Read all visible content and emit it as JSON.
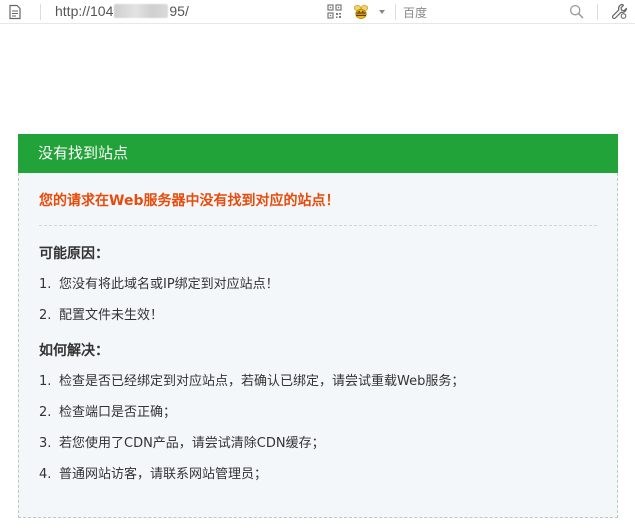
{
  "browser": {
    "url_prefix": "http://104",
    "url_suffix": "95/",
    "search_placeholder": "百度",
    "icons": {
      "page": "page-icon",
      "qr": "qr-code-icon",
      "extension": "bee-icon",
      "dropdown": "chevron-down-icon",
      "search": "search-icon",
      "tools": "wrench-icon"
    }
  },
  "panel": {
    "header_title": "没有找到站点",
    "error_message": "您的请求在Web服务器中没有找到对应的站点！",
    "reasons_title": "可能原因：",
    "reasons": [
      {
        "num": "1.",
        "text": "您没有将此域名或IP绑定到对应站点！"
      },
      {
        "num": "2.",
        "text": "配置文件未生效！"
      }
    ],
    "solutions_title": "如何解决：",
    "solutions": [
      {
        "num": "1.",
        "text": "检查是否已经绑定到对应站点，若确认已绑定，请尝试重载Web服务；"
      },
      {
        "num": "2.",
        "text": "检查端口是否正确；"
      },
      {
        "num": "3.",
        "text": "若您使用了CDN产品，请尝试清除CDN缓存；"
      },
      {
        "num": "4.",
        "text": "普通网站访客，请联系网站管理员；"
      }
    ]
  },
  "colors": {
    "header_green": "#22a33a",
    "error_orange": "#e74c0c",
    "panel_bg": "#f4f7f9"
  }
}
